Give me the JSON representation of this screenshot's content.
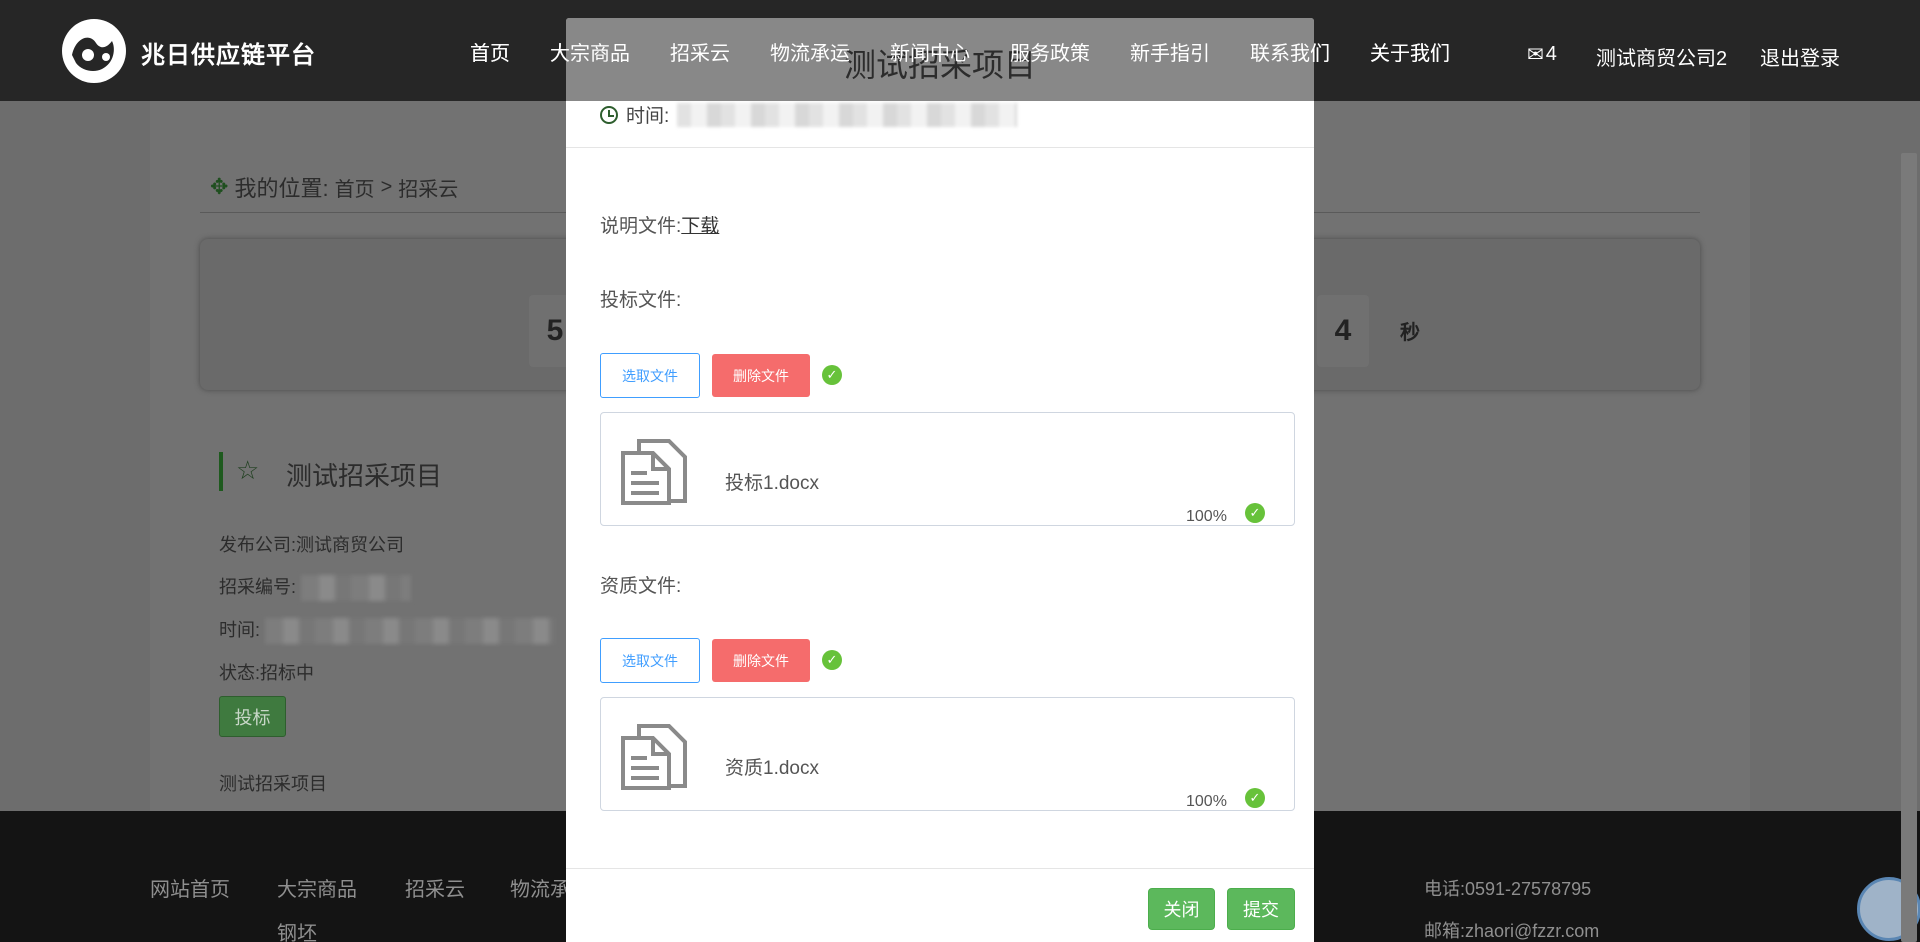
{
  "header": {
    "brand": "兆日供应链平台",
    "nav": [
      "首页",
      "大宗商品",
      "招采云",
      "物流承运",
      "新闻中心",
      "服务政策",
      "新手指引",
      "联系我们",
      "关于我们"
    ],
    "message_count": "4",
    "user": "测试商贸公司2",
    "logout": "退出登录"
  },
  "breadcrumb": {
    "label": "我的位置:",
    "home": "首页",
    "sep": ">",
    "current": "招采云"
  },
  "countdown": {
    "first_digit": "5",
    "last_digit": "4",
    "unit": "秒"
  },
  "project": {
    "title": "测试招采项目",
    "company": "发布公司:测试商贸公司",
    "code_label": "招采编号:",
    "time_label": "时间:",
    "status": "状态:招标中",
    "bid_button": "投标",
    "description": "测试招采项目"
  },
  "footer": {
    "links": [
      "网站首页",
      "大宗商品",
      "招采云",
      "物流承",
      "钢坯"
    ],
    "phone": "电话:0591-27578795",
    "email": "邮箱:zhaori@fzzr.com"
  },
  "modal": {
    "title": "测试招采项目",
    "time_label": "时间:",
    "instruction_label": "说明文件:",
    "instruction_link": "下载",
    "bid_label": "投标文件:",
    "qual_label": "资质文件:",
    "select_button": "选取文件",
    "delete_button": "删除文件",
    "bid_file": {
      "name": "投标1.docx",
      "progress": "100%"
    },
    "qual_file": {
      "name": "资质1.docx",
      "progress": "100%"
    },
    "close_button": "关闭",
    "submit_button": "提交"
  },
  "colors": {
    "primary_blue": "#409eff",
    "danger_red": "#f56c6c",
    "success_green": "#5cb85c",
    "check_green": "#67c23a"
  }
}
